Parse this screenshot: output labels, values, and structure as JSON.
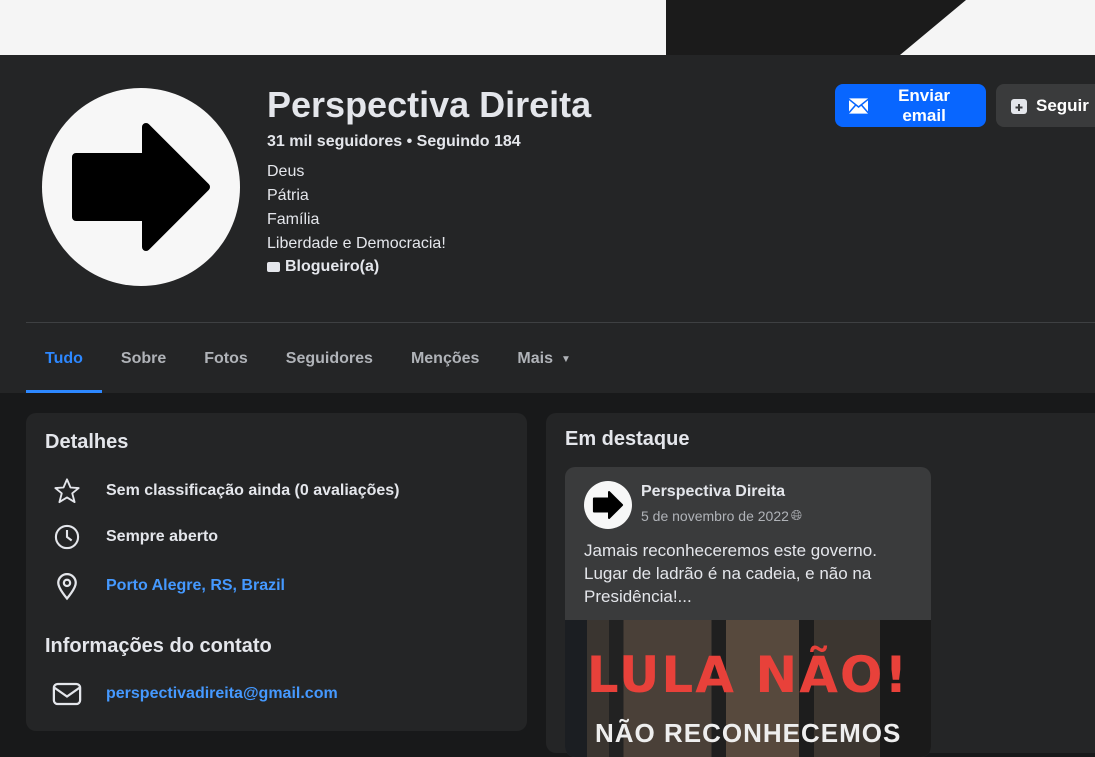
{
  "profile": {
    "name": "Perspectiva Direita",
    "stats": "31 mil seguidores • Seguindo 184",
    "bio": [
      "Deus",
      "Pátria",
      "Família",
      "Liberdade e Democracia!"
    ],
    "category": "Blogueiro(a)"
  },
  "actions": {
    "email": "Enviar email",
    "follow": "Seguir"
  },
  "tabs": [
    "Tudo",
    "Sobre",
    "Fotos",
    "Seguidores",
    "Menções",
    "Mais"
  ],
  "details": {
    "title": "Detalhes",
    "rating": "Sem classificação ainda (0 avaliações)",
    "hours": "Sempre aberto",
    "location": "Porto Alegre, RS, Brazil",
    "contact_title": "Informações do contato",
    "email": "perspectivadireita@gmail.com"
  },
  "featured": {
    "title": "Em destaque",
    "post": {
      "author": "Perspectiva Direita",
      "date": "5 de novembro de 2022",
      "text": "Jamais reconheceremos este governo. Lugar de ladrão é na cadeia, e não na Presidência!...",
      "image_text": "LULA NÃO!",
      "image_subtext": "NÃO RECONHECEMOS"
    }
  }
}
